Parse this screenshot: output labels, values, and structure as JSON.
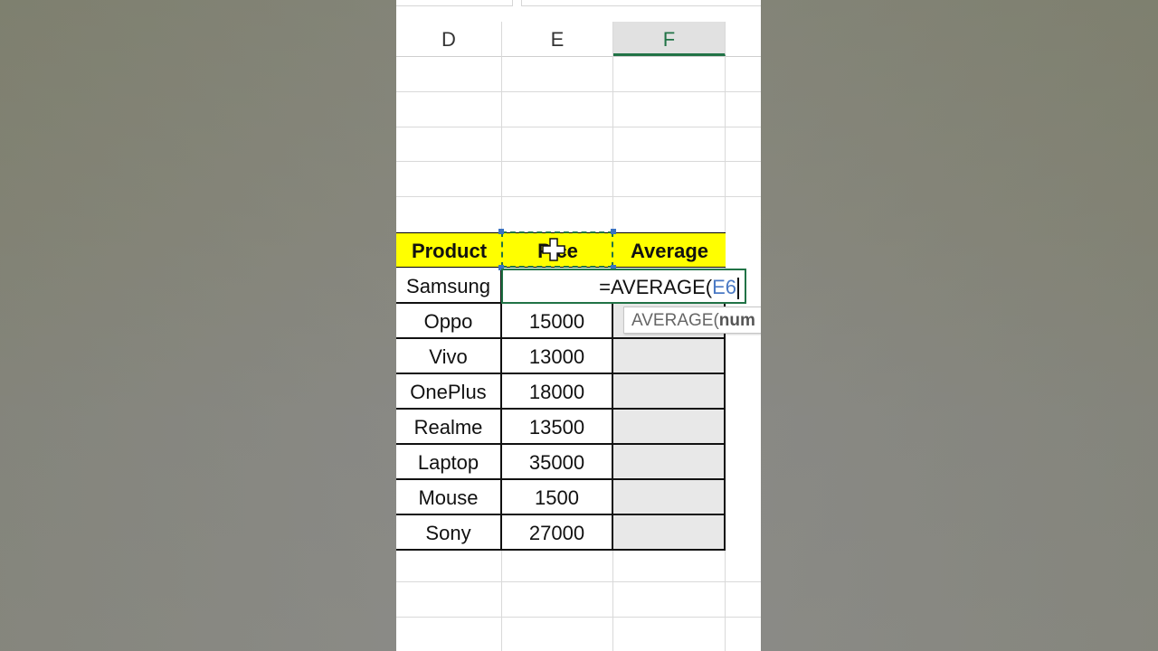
{
  "columns": [
    "D",
    "E",
    "F"
  ],
  "selected_column": "F",
  "table": {
    "headers": [
      "Product",
      "Price",
      "Average"
    ],
    "header_price_visible": "P  ce",
    "rows": [
      {
        "product": "Samsung",
        "price": ""
      },
      {
        "product": "Oppo",
        "price": "15000"
      },
      {
        "product": "Vivo",
        "price": "13000"
      },
      {
        "product": "OnePlus",
        "price": "18000"
      },
      {
        "product": "Realme",
        "price": "13500"
      },
      {
        "product": "Laptop",
        "price": "35000"
      },
      {
        "product": "Mouse",
        "price": "1500"
      },
      {
        "product": "Sony",
        "price": "27000"
      }
    ]
  },
  "formula": {
    "prefix": "=AVERAGE(",
    "reference": "E6"
  },
  "tooltip": {
    "function": "AVERAGE(",
    "arg": "num"
  },
  "colors": {
    "header_fill": "#ffff00",
    "excel_green": "#217346",
    "reference_blue": "#4a79c4"
  },
  "icons": [
    "move-cursor-icon"
  ]
}
